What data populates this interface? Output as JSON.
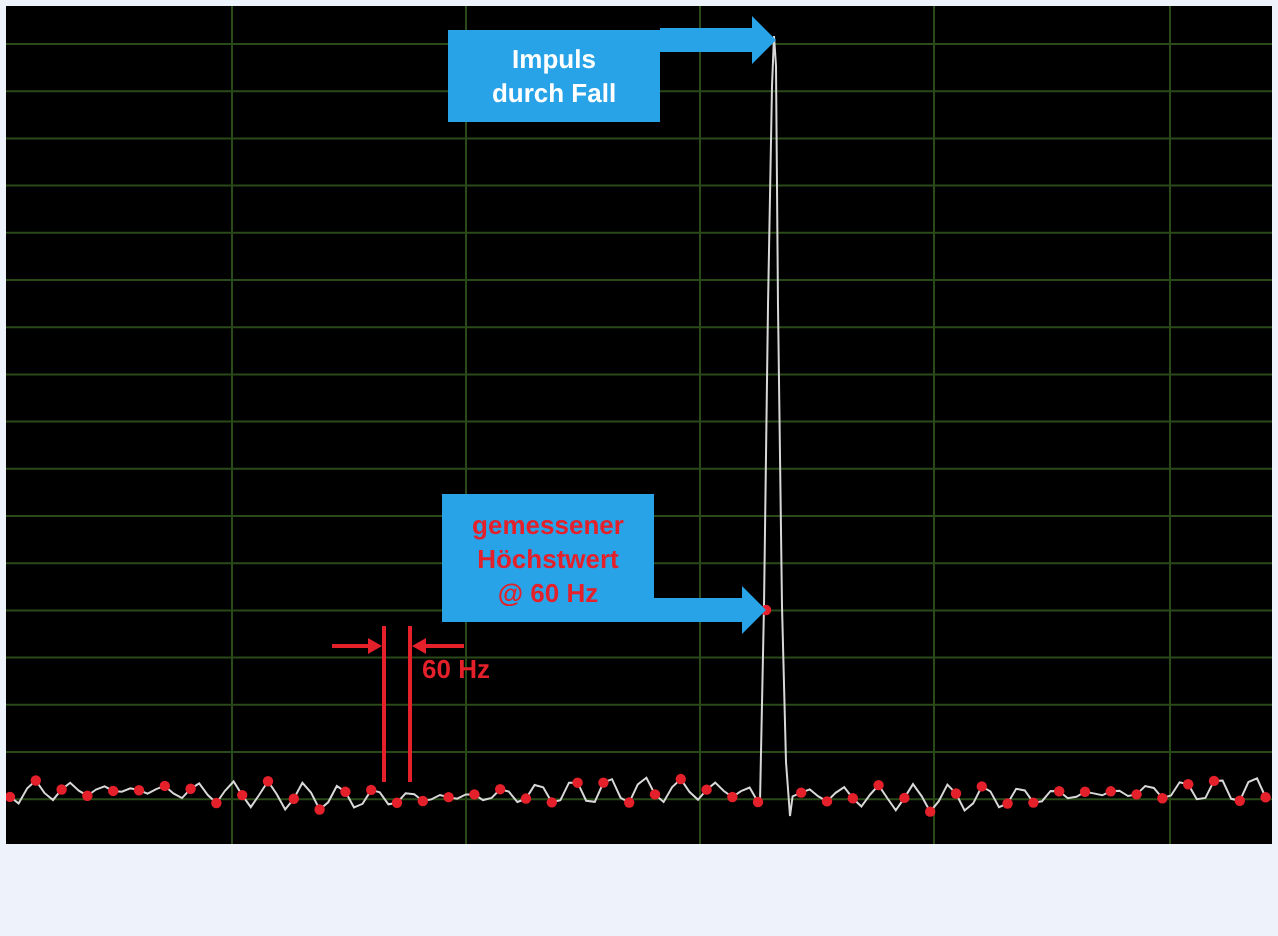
{
  "plot": {
    "callouts": [
      {
        "kind": "note",
        "lines": [
          "Impuls",
          "durch Fall"
        ]
      },
      {
        "kind": "measurement",
        "lines": [
          "gemessener",
          "Höchstwert",
          "@ 60 Hz"
        ]
      }
    ],
    "spacing_label": "60 Hz"
  }
}
